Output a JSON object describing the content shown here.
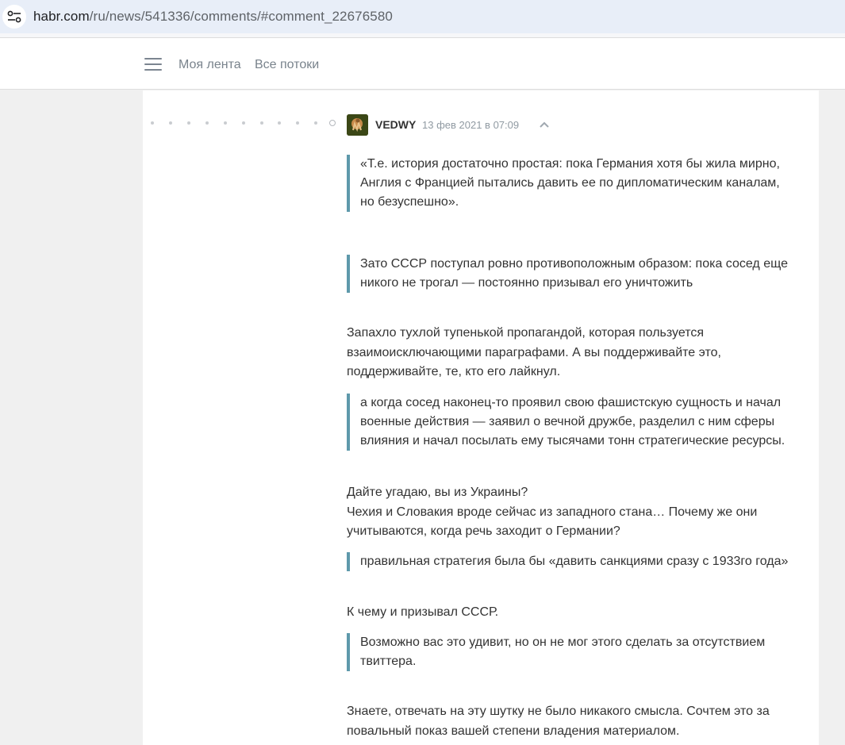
{
  "browser": {
    "url_host": "habr.com",
    "url_path": "/ru/news/541336/comments/#comment_22676580"
  },
  "header": {
    "nav": [
      {
        "label": "Моя лента"
      },
      {
        "label": "Все потоки"
      }
    ]
  },
  "comment": {
    "author": "VEDWY",
    "timestamp": "13 фев 2021 в 07:09",
    "blocks": [
      {
        "type": "quote",
        "lines": [
          "«Т.е. история достаточно простая: пока Германия хотя бы жила мирно,",
          "Англия с Францией пытались давить ее по дипломатическим каналам,",
          "но безуспешно»."
        ]
      },
      {
        "type": "quote",
        "lines": [
          "Зато СССР поступал ровно противоположным образом: пока сосед еще",
          "никого не трогал — постоянно призывал его уничтожить"
        ]
      },
      {
        "type": "text",
        "lines": [
          "Запахло тухлой тупенькой пропагандой, которая пользуется",
          "взаимоисключающими параграфами. А вы поддерживайте это,",
          "поддерживайте, те, кто его лайкнул."
        ]
      },
      {
        "type": "quote",
        "lines": [
          "а когда сосед наконец-то проявил свою фашистскую сущность и начал",
          "военные действия — заявил о вечной дружбе, разделил с ним сферы",
          "влияния и начал посылать ему тысячами тонн стратегические ресурсы."
        ]
      },
      {
        "type": "text",
        "lines": [
          "Дайте угадаю, вы из Украины?",
          "Чехия и Словакия вроде сейчас из западного стана… Почему же они",
          "учитываются, когда речь заходит о Германии?"
        ]
      },
      {
        "type": "quote",
        "lines": [
          "правильная стратегия была бы «давить санкциями сразу с 1933го года»"
        ]
      },
      {
        "type": "text",
        "lines": [
          "К чему и призывал СССР."
        ]
      },
      {
        "type": "quote",
        "lines": [
          "Возможно вас это удивит, но он не мог этого сделать за отсутствием",
          "твиттера."
        ]
      },
      {
        "type": "text",
        "lines": [
          "Знаете, отвечать на эту шутку не было никакого смысла. Сочтем это за",
          "повальный показ вашей степени владения материалом."
        ]
      }
    ]
  },
  "icons": {
    "site_info": "tune-icon",
    "menu": "hamburger-icon",
    "collapse": "chevron-up-icon"
  },
  "colors": {
    "quote_bar": "#5e99ab",
    "page_bg": "#f0f0f0",
    "card_bg": "#ffffff"
  }
}
